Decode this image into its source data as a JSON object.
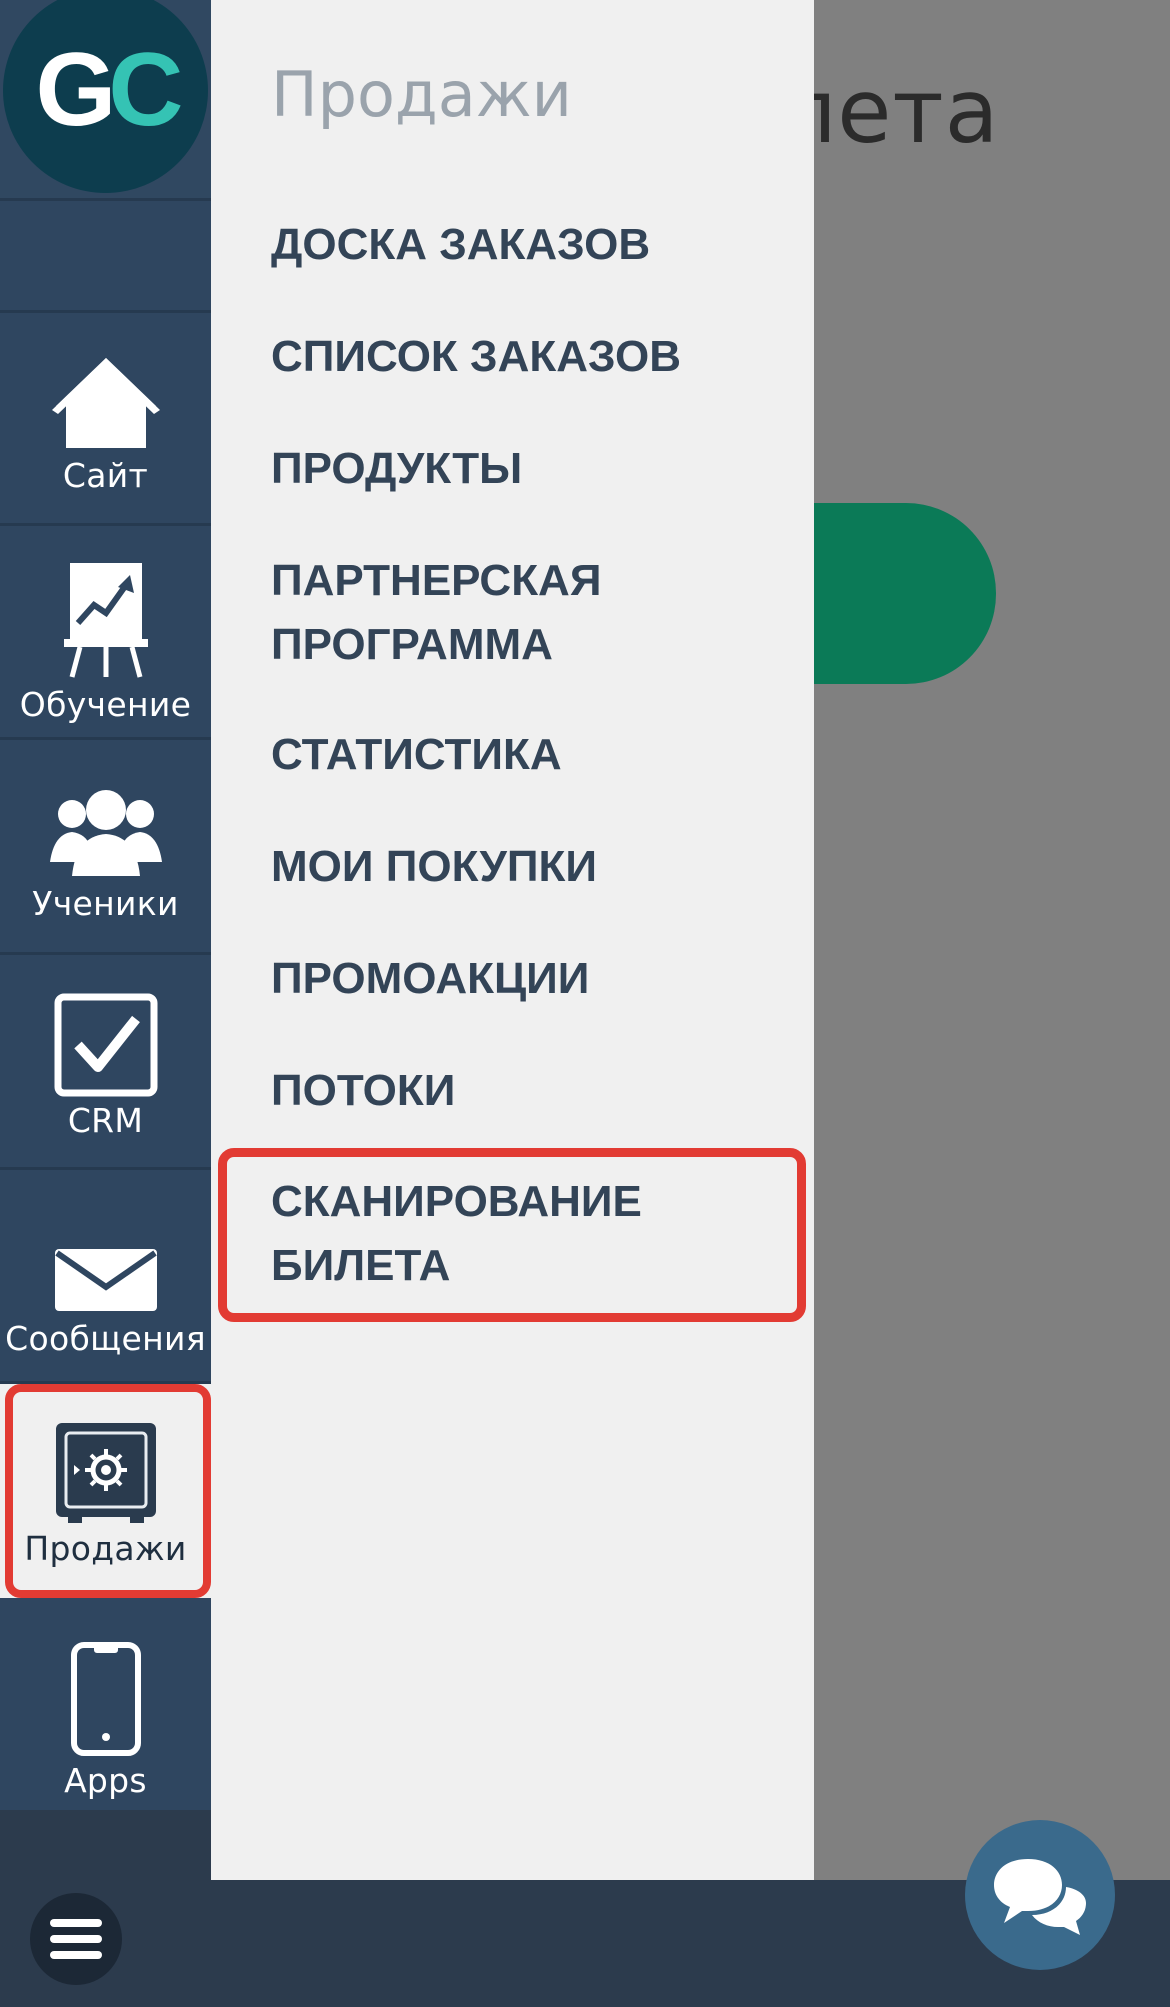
{
  "background": {
    "title_fragment": "лета"
  },
  "logo": {
    "g": "G",
    "c": "C"
  },
  "sidebar": {
    "items": [
      {
        "label": "Сайт",
        "icon": "home-icon"
      },
      {
        "label": "Обучение",
        "icon": "presentation-chart-icon"
      },
      {
        "label": "Ученики",
        "icon": "users-icon"
      },
      {
        "label": "CRM",
        "icon": "checkbox-icon"
      },
      {
        "label": "Сообщения",
        "icon": "envelope-icon"
      },
      {
        "label": "Продажи",
        "icon": "safe-icon"
      },
      {
        "label": "Apps",
        "icon": "smartphone-icon"
      }
    ]
  },
  "menu": {
    "title": "Продажи",
    "items": [
      {
        "label": "ДОСКА ЗАКАЗОВ"
      },
      {
        "label": "СПИСОК ЗАКАЗОВ"
      },
      {
        "label": "ПРОДУКТЫ"
      },
      {
        "label": "ПАРТНЕРСКАЯ ПРОГРАММА"
      },
      {
        "label": "СТАТИСТИКА"
      },
      {
        "label": "МОИ ПОКУПКИ"
      },
      {
        "label": "ПРОМОАКЦИИ"
      },
      {
        "label": "ПОТОКИ"
      },
      {
        "label": "СКАНИРОВАНИЕ БИЛЕТА"
      }
    ]
  },
  "colors": {
    "sidebar": "#2f4660",
    "menu_bg": "#f0f0f0",
    "highlight": "#e23b33",
    "accent_green": "#0b7a57",
    "chat_button": "#3a6a8c"
  }
}
